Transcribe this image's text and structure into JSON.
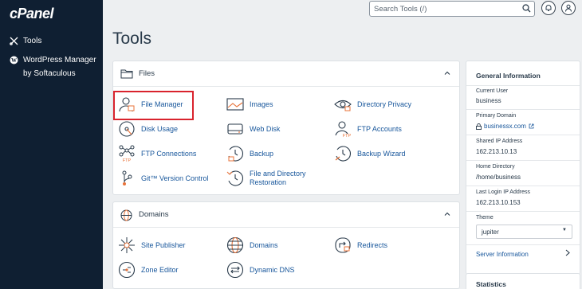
{
  "app": {
    "logo": "cPanel"
  },
  "sidebar": {
    "items": [
      {
        "label": "Tools",
        "icon": "tools-icon"
      },
      {
        "label": "WordPress Manager by Softaculous",
        "icon": "wordpress-icon"
      }
    ]
  },
  "header": {
    "search_placeholder": "Search Tools (/)"
  },
  "page": {
    "title": "Tools"
  },
  "files": {
    "title": "Files",
    "tools": [
      {
        "label": "File Manager",
        "icon": "file-manager-icon"
      },
      {
        "label": "Images",
        "icon": "images-icon"
      },
      {
        "label": "Directory Privacy",
        "icon": "directory-privacy-icon"
      },
      {
        "label": "Disk Usage",
        "icon": "disk-usage-icon"
      },
      {
        "label": "Web Disk",
        "icon": "web-disk-icon"
      },
      {
        "label": "FTP Accounts",
        "icon": "ftp-accounts-icon"
      },
      {
        "label": "FTP Connections",
        "icon": "ftp-connections-icon"
      },
      {
        "label": "Backup",
        "icon": "backup-icon"
      },
      {
        "label": "Backup Wizard",
        "icon": "backup-wizard-icon"
      },
      {
        "label": "Git™ Version Control",
        "icon": "git-icon"
      },
      {
        "label": "File and Directory Restoration",
        "icon": "restoration-icon"
      }
    ]
  },
  "domains": {
    "title": "Domains",
    "tools": [
      {
        "label": "Site Publisher",
        "icon": "site-publisher-icon"
      },
      {
        "label": "Domains",
        "icon": "domains-icon"
      },
      {
        "label": "Redirects",
        "icon": "redirects-icon"
      },
      {
        "label": "Zone Editor",
        "icon": "zone-editor-icon"
      },
      {
        "label": "Dynamic DNS",
        "icon": "dynamic-dns-icon"
      }
    ]
  },
  "general_info": {
    "title": "General Information",
    "current_user_label": "Current User",
    "current_user": "business",
    "primary_domain_label": "Primary Domain",
    "primary_domain": "businessx.com",
    "shared_ip_label": "Shared IP Address",
    "shared_ip": "162.213.10.13",
    "home_dir_label": "Home Directory",
    "home_dir": "/home/business",
    "last_login_label": "Last Login IP Address",
    "last_login": "162.213.10.153",
    "theme_label": "Theme",
    "theme": "jupiter",
    "server_info": "Server Information"
  },
  "statistics": {
    "title": "Statistics"
  },
  "colors": {
    "sidebar": "#0f1f32",
    "link": "#17569b",
    "highlight": "#d9232d",
    "accent": "#e8733a"
  }
}
